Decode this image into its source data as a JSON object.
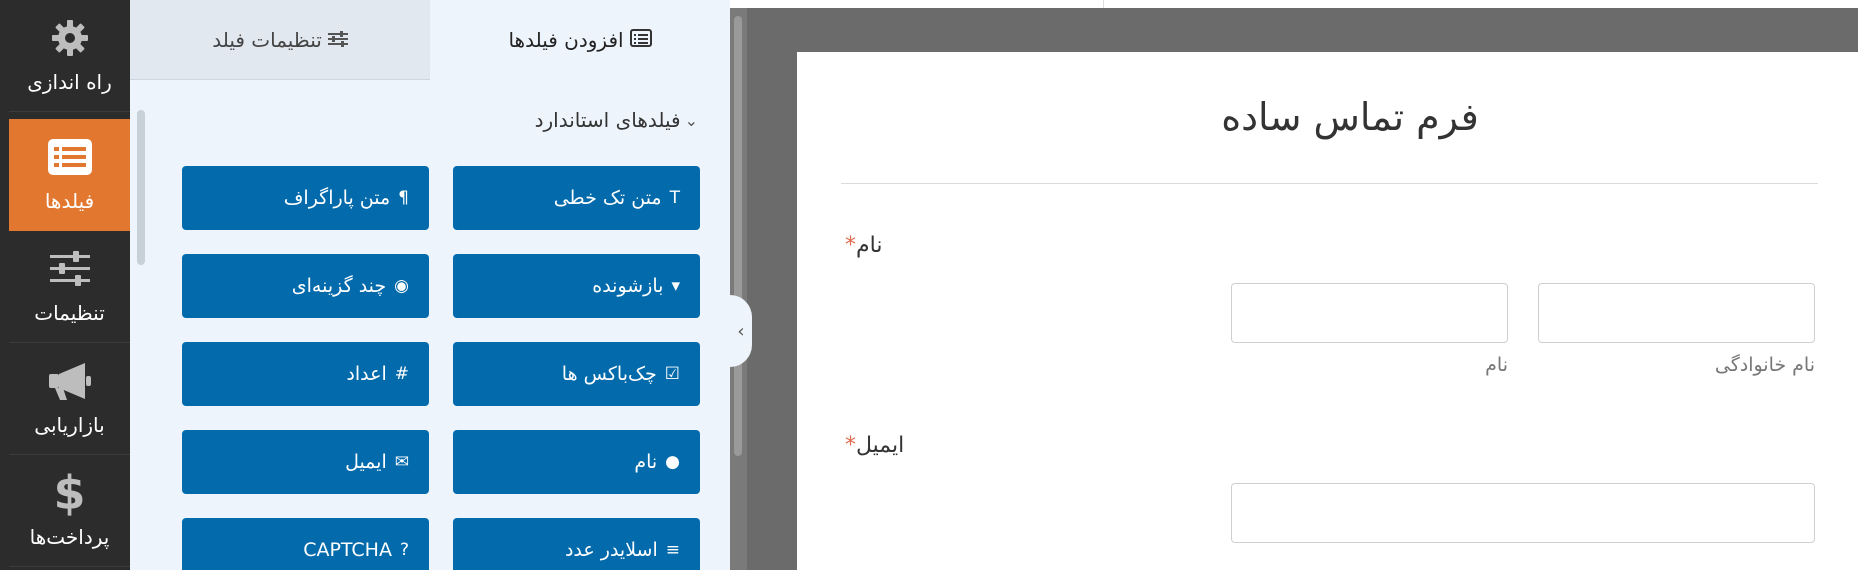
{
  "sidebar": {
    "items": [
      {
        "label": "راه اندازی",
        "icon": "gear-icon"
      },
      {
        "label": "فیلدها",
        "icon": "fields-list-icon"
      },
      {
        "label": "تنظیمات",
        "icon": "sliders-icon"
      },
      {
        "label": "بازاریابی",
        "icon": "megaphone-icon"
      },
      {
        "label": "پرداخت‌ها",
        "icon": "dollar-icon"
      }
    ],
    "active_color": "#e27730"
  },
  "panel": {
    "tabs": {
      "add_fields": "افزودن فیلدها",
      "field_settings": "تنظیمات فیلد"
    },
    "section_title": "فیلدهای استاندارد",
    "buttons": [
      {
        "label": "متن تک خطی",
        "icon": "text-icon",
        "glyph": "T"
      },
      {
        "label": "متن پاراگراف",
        "icon": "paragraph-icon",
        "glyph": "¶"
      },
      {
        "label": "بازشونده",
        "icon": "dropdown-icon",
        "glyph": "▾"
      },
      {
        "label": "چند گزینه‌ای",
        "icon": "radio-icon",
        "glyph": "◉"
      },
      {
        "label": "چک‌باکس ها",
        "icon": "checkbox-icon",
        "glyph": "☑"
      },
      {
        "label": "اعداد",
        "icon": "hash-icon",
        "glyph": "#"
      },
      {
        "label": "نام",
        "icon": "user-icon",
        "glyph": "●"
      },
      {
        "label": "ایمیل",
        "icon": "envelope-icon",
        "glyph": "✉"
      },
      {
        "label": "اسلایدر عدد",
        "icon": "slider-icon",
        "glyph": "≡"
      },
      {
        "label": "CAPTCHA",
        "icon": "question-circle-icon",
        "glyph": "?"
      }
    ],
    "button_color": "#036aab"
  },
  "form": {
    "title": "فرم تماس ساده",
    "name_label": "نام",
    "required_mark": "*",
    "first_name_sub": "نام",
    "last_name_sub": "نام خانوادگی",
    "email_label": "ایمیل"
  }
}
